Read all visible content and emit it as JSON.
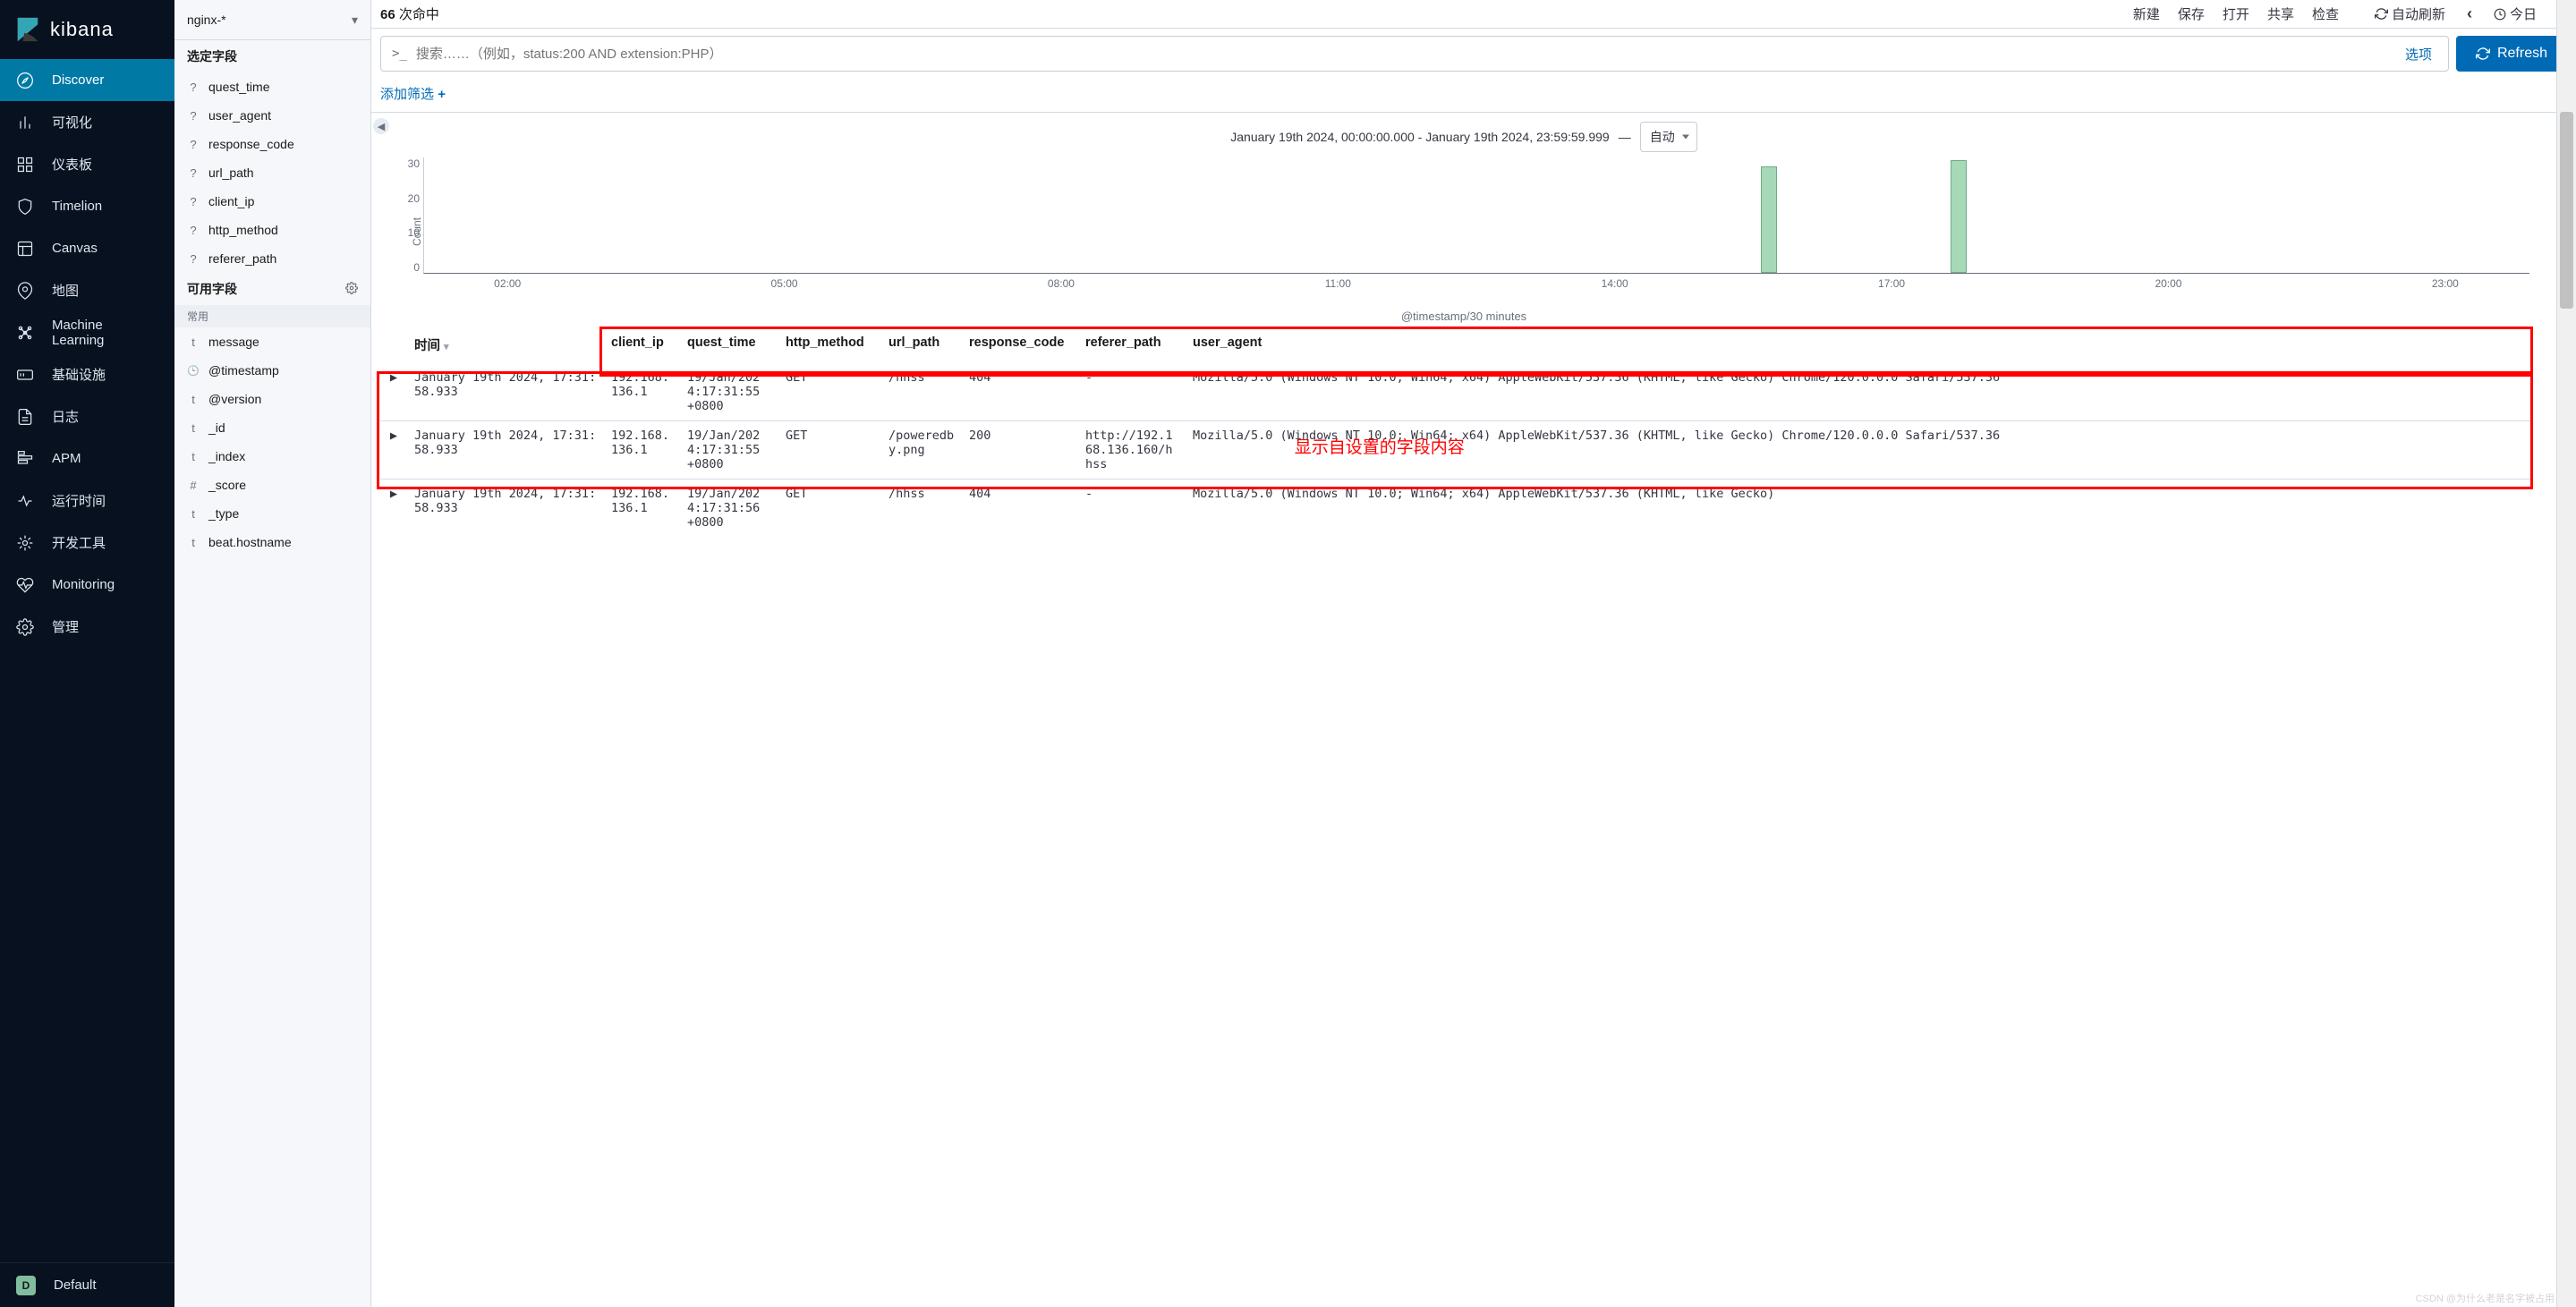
{
  "brand": "kibana",
  "nav": {
    "items": [
      {
        "label": "Discover",
        "icon": "compass",
        "active": true
      },
      {
        "label": "可视化",
        "icon": "bar-chart"
      },
      {
        "label": "仪表板",
        "icon": "dashboard"
      },
      {
        "label": "Timelion",
        "icon": "shield"
      },
      {
        "label": "Canvas",
        "icon": "frame"
      },
      {
        "label": "地图",
        "icon": "map-pin"
      },
      {
        "label": "Machine Learning",
        "icon": "ml"
      },
      {
        "label": "基础设施",
        "icon": "infra"
      },
      {
        "label": "日志",
        "icon": "logs"
      },
      {
        "label": "APM",
        "icon": "apm"
      },
      {
        "label": "运行时间",
        "icon": "uptime"
      },
      {
        "label": "开发工具",
        "icon": "wrench"
      },
      {
        "label": "Monitoring",
        "icon": "heart"
      },
      {
        "label": "管理",
        "icon": "gear"
      }
    ],
    "default_badge": "D",
    "default_label": "Default"
  },
  "fields_panel": {
    "index_pattern": "nginx-*",
    "selected_header": "选定字段",
    "selected": [
      {
        "type": "?",
        "name": "quest_time"
      },
      {
        "type": "?",
        "name": "user_agent"
      },
      {
        "type": "?",
        "name": "response_code"
      },
      {
        "type": "?",
        "name": "url_path"
      },
      {
        "type": "?",
        "name": "client_ip"
      },
      {
        "type": "?",
        "name": "http_method"
      },
      {
        "type": "?",
        "name": "referer_path"
      }
    ],
    "available_header": "可用字段",
    "common_label": "常用",
    "available": [
      {
        "type": "t",
        "name": "message"
      },
      {
        "type": "clock",
        "name": "@timestamp"
      },
      {
        "type": "t",
        "name": "@version"
      },
      {
        "type": "t",
        "name": "_id"
      },
      {
        "type": "t",
        "name": "_index"
      },
      {
        "type": "#",
        "name": "_score"
      },
      {
        "type": "t",
        "name": "_type"
      },
      {
        "type": "t",
        "name": "beat.hostname"
      }
    ]
  },
  "top": {
    "hits_count": "66",
    "hits_label": " 次命中",
    "actions": [
      "新建",
      "保存",
      "打开",
      "共享",
      "检查"
    ],
    "auto_refresh": "自动刷新",
    "today": "今日"
  },
  "search": {
    "prompt": ">_",
    "placeholder": "搜索……（例如，status:200 AND extension:PHP）",
    "options": "选项",
    "refresh": "Refresh"
  },
  "filter": {
    "add": "添加筛选",
    "plus": "+"
  },
  "timerange": {
    "text": "January 19th 2024, 00:00:00.000 - January 19th 2024, 23:59:59.999",
    "dash": "—",
    "auto": "自动"
  },
  "chart_data": {
    "type": "bar",
    "ylabel": "Count",
    "xlabel": "@timestamp/30 minutes",
    "y_ticks": [
      "30",
      "20",
      "10",
      "0"
    ],
    "x_ticks": [
      "02:00",
      "05:00",
      "08:00",
      "11:00",
      "14:00",
      "17:00",
      "20:00",
      "23:00"
    ],
    "ylim": [
      0,
      35
    ],
    "bars": [
      {
        "x_pct": 63.5,
        "value": 32
      },
      {
        "x_pct": 72.5,
        "value": 34
      }
    ]
  },
  "table": {
    "columns": [
      "时间",
      "client_ip",
      "quest_time",
      "http_method",
      "url_path",
      "response_code",
      "referer_path",
      "user_agent"
    ],
    "annotation": "显示自设置的字段内容",
    "rows": [
      {
        "time": "January 19th 2024, 17:31:58.933",
        "client_ip": "192.168.136.1",
        "quest_time": "19/Jan/2024:17:31:55 +0800",
        "http_method": "GET",
        "url_path": "/hhss",
        "response_code": "404",
        "referer_path": "-",
        "user_agent": "Mozilla/5.0 (Windows NT 10.0; Win64; x64) AppleWebKit/537.36 (KHTML, like Gecko) Chrome/120.0.0.0 Safari/537.36"
      },
      {
        "time": "January 19th 2024, 17:31:58.933",
        "client_ip": "192.168.136.1",
        "quest_time": "19/Jan/2024:17:31:55 +0800",
        "http_method": "GET",
        "url_path": "/poweredby.png",
        "response_code": "200",
        "referer_path": "http://192.168.136.160/hhss",
        "user_agent": "Mozilla/5.0 (Windows NT 10.0; Win64; x64) AppleWebKit/537.36 (KHTML, like Gecko) Chrome/120.0.0.0 Safari/537.36"
      },
      {
        "time": "January 19th 2024, 17:31:58.933",
        "client_ip": "192.168.136.1",
        "quest_time": "19/Jan/2024:17:31:56 +0800",
        "http_method": "GET",
        "url_path": "/hhss",
        "response_code": "404",
        "referer_path": "-",
        "user_agent": "Mozilla/5.0 (Windows NT 10.0; Win64; x64) AppleWebKit/537.36 (KHTML, like Gecko)"
      }
    ]
  },
  "watermark": "CSDN @为什么老是名字被占用"
}
